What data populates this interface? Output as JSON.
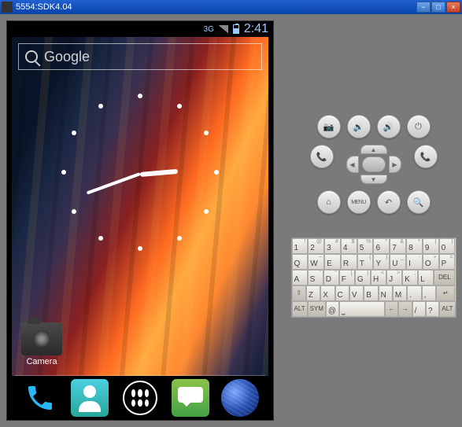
{
  "window": {
    "title": "5554:SDK4.04"
  },
  "status": {
    "network": "3G",
    "time": "2:41"
  },
  "search": {
    "placeholder": "Google"
  },
  "camera": {
    "label": "Camera"
  },
  "hwLabels": {
    "menu": "MENU"
  },
  "keyboard": {
    "row1": [
      {
        "main": "1",
        "sup": "!"
      },
      {
        "main": "2",
        "sup": "@"
      },
      {
        "main": "3",
        "sup": "#"
      },
      {
        "main": "4",
        "sup": "$"
      },
      {
        "main": "5",
        "sup": "%"
      },
      {
        "main": "6",
        "sup": "^"
      },
      {
        "main": "7",
        "sup": "&"
      },
      {
        "main": "8",
        "sup": "*"
      },
      {
        "main": "9",
        "sup": "("
      },
      {
        "main": "0",
        "sup": ")"
      }
    ],
    "row2": [
      {
        "main": "Q"
      },
      {
        "main": "W",
        "sup": "~"
      },
      {
        "main": "E",
        "sup": "´"
      },
      {
        "main": "R",
        "sup": "`"
      },
      {
        "main": "T",
        "sup": "{"
      },
      {
        "main": "Y",
        "sup": "}"
      },
      {
        "main": "U",
        "sup": "_"
      },
      {
        "main": "I",
        "sup": "-"
      },
      {
        "main": "O",
        "sup": "+"
      },
      {
        "main": "P",
        "sup": "="
      }
    ],
    "row3": [
      {
        "main": "A"
      },
      {
        "main": "S",
        "sup": "'"
      },
      {
        "main": "D",
        "sup": "\""
      },
      {
        "main": "F",
        "sup": "["
      },
      {
        "main": "G",
        "sup": "]"
      },
      {
        "main": "H",
        "sup": "<"
      },
      {
        "main": "J",
        "sup": ">"
      },
      {
        "main": "K",
        "sup": ";"
      },
      {
        "main": "L",
        "sup": ":"
      }
    ],
    "row3_del": "DEL",
    "row4_shift": "⇧",
    "row4": [
      {
        "main": "Z"
      },
      {
        "main": "X"
      },
      {
        "main": "C"
      },
      {
        "main": "V"
      },
      {
        "main": "B"
      },
      {
        "main": "N"
      },
      {
        "main": "M"
      },
      {
        "main": "."
      },
      {
        "main": ","
      }
    ],
    "row4_enter": "↵",
    "row5": {
      "alt1": "ALT",
      "sym": "SYM",
      "at": "@",
      "space": "⎵",
      "slash": "/",
      "q": "?",
      "alt2": "ALT"
    }
  }
}
